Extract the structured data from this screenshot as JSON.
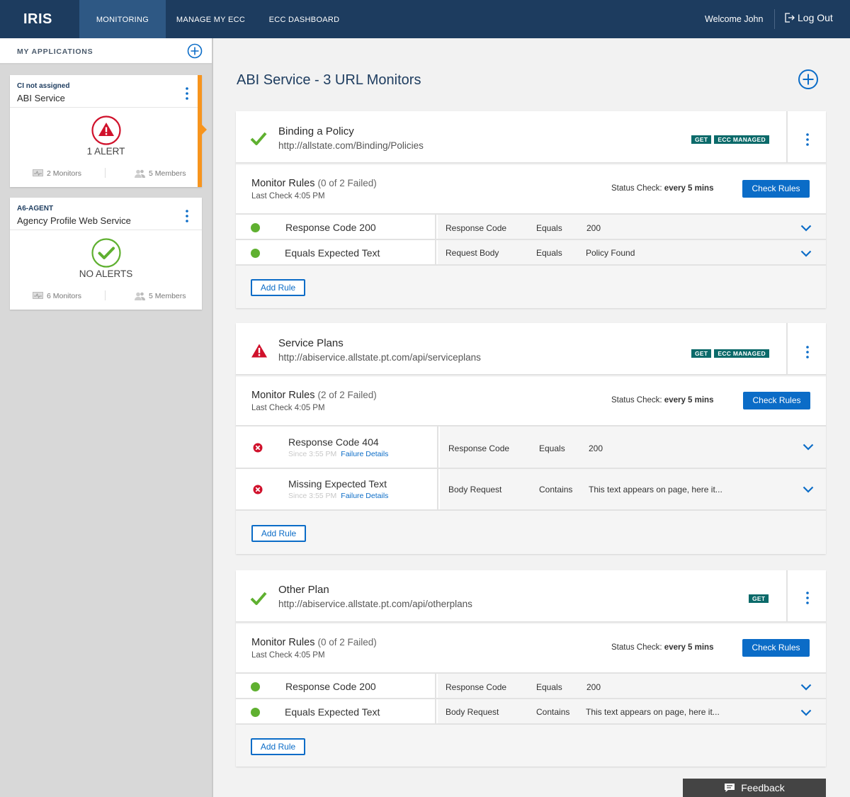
{
  "nav": {
    "logo": "IRIS",
    "tabs": [
      {
        "label": "MONITORING",
        "active": true
      },
      {
        "label": "MANAGE MY ECC",
        "active": false
      },
      {
        "label": "ECC DASHBOARD",
        "active": false
      }
    ],
    "welcome": "Welcome John",
    "logout": "Log Out"
  },
  "sidebar": {
    "title": "MY APPLICATIONS",
    "apps": [
      {
        "code": "CI not assigned",
        "name": "ABI Service",
        "status": "1 ALERT",
        "monitors": "2 Monitors",
        "members": "5 Members"
      },
      {
        "code": "A6-AGENT",
        "name": "Agency Profile Web Service",
        "status": "NO ALERTS",
        "monitors": "6 Monitors",
        "members": "5 Members"
      }
    ]
  },
  "main": {
    "title": "ABI Service - 3 URL Monitors",
    "monitors": [
      {
        "status": "ok",
        "title": "Binding a Policy",
        "url": "http://allstate.com/Binding/Policies",
        "badges": [
          "GET",
          "ECC MANAGED"
        ],
        "rules_title": "Monitor Rules",
        "rules_count": "(0 of 2 Failed)",
        "last_check": "Last Check 4:05 PM",
        "status_check_label": "Status Check:",
        "status_check_value": "every 5 mins",
        "check_button": "Check Rules",
        "add_rule": "Add Rule",
        "rules": [
          {
            "name": "Response Code 200",
            "field": "Response Code",
            "op": "Equals",
            "value": "200"
          },
          {
            "name": "Equals Expected Text",
            "field": "Request Body",
            "op": "Equals",
            "value": "Policy Found"
          }
        ]
      },
      {
        "status": "alert",
        "title": "Service Plans",
        "url": "http://abiservice.allstate.pt.com/api/serviceplans",
        "badges": [
          "GET",
          "ECC MANAGED"
        ],
        "rules_title": "Monitor Rules",
        "rules_count": "(2 of 2 Failed)",
        "last_check": "Last Check 4:05 PM",
        "status_check_label": "Status Check:",
        "status_check_value": "every 5 mins",
        "check_button": "Check Rules",
        "add_rule": "Add Rule",
        "rules": [
          {
            "name": "Response Code 404",
            "since": "Since 3:55 PM",
            "details": "Failure Details",
            "field": "Response Code",
            "op": "Equals",
            "value": "200"
          },
          {
            "name": "Missing Expected Text",
            "since": "Since 3:55 PM",
            "details": "Failure Details",
            "field": "Body Request",
            "op": "Contains",
            "value": "This text appears on page, here it..."
          }
        ]
      },
      {
        "status": "ok",
        "title": "Other Plan",
        "url": "http://abiservice.allstate.pt.com/api/otherplans",
        "badges": [
          "GET"
        ],
        "rules_title": "Monitor Rules",
        "rules_count": "(0 of 2 Failed)",
        "last_check": "Last Check 4:05 PM",
        "status_check_label": "Status Check:",
        "status_check_value": "every 5 mins",
        "check_button": "Check Rules",
        "add_rule": "Add Rule",
        "rules": [
          {
            "name": "Response Code 200",
            "field": "Response Code",
            "op": "Equals",
            "value": "200"
          },
          {
            "name": "Equals Expected Text",
            "field": "Body Request",
            "op": "Contains",
            "value": "This text appears on page, here it..."
          }
        ]
      }
    ]
  },
  "feedback": "Feedback",
  "colors": {
    "nav": "#1d3c5f",
    "nav_active": "#2e5884",
    "accent": "#0b6cc7",
    "ok": "#5fb030",
    "alert": "#d0112b",
    "selected": "#f7941d",
    "badge": "#0b6a6a"
  }
}
